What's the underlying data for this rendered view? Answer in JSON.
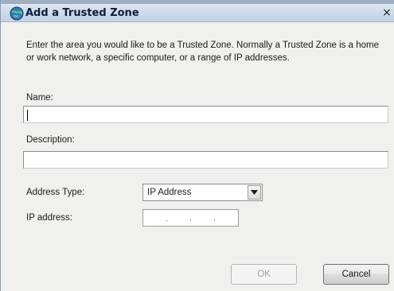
{
  "window": {
    "title": "Add a Trusted Zone",
    "close_glyph": "×"
  },
  "intro_text": "Enter the area you would like to be a Trusted Zone. Normally a Trusted Zone is a home or work network, a specific computer, or a range of IP addresses.",
  "fields": {
    "name": {
      "label": "Name:",
      "value": ""
    },
    "description": {
      "label": "Description:",
      "value": ""
    },
    "address_type": {
      "label": "Address Type:",
      "selected": "IP Address"
    },
    "ip_address": {
      "label": "IP address:",
      "value": ""
    }
  },
  "buttons": {
    "ok": "OK",
    "cancel": "Cancel"
  },
  "icons": {
    "title": "trusted-zone-globe-icon",
    "dropdown": "chevron-down-icon",
    "close": "close-icon"
  },
  "colors": {
    "titlebar": "#cfdbea",
    "dialog_bg": "#f0f0ef",
    "disabled_text": "#a0a0a0"
  }
}
